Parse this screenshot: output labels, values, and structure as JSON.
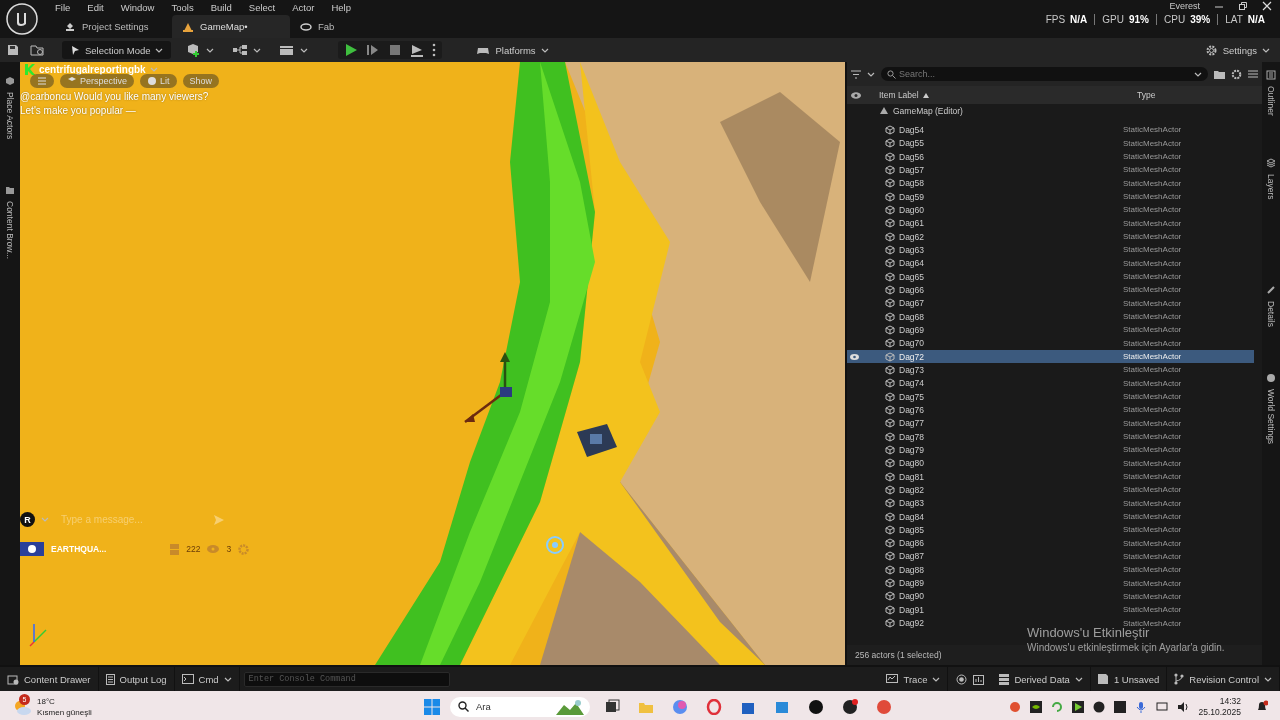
{
  "menu": [
    "File",
    "Edit",
    "Window",
    "Tools",
    "Build",
    "Select",
    "Actor",
    "Help"
  ],
  "tabs": [
    {
      "label": "Project Settings",
      "selected": false
    },
    {
      "label": "GameMap•",
      "selected": true
    },
    {
      "label": "Fab",
      "selected": false
    }
  ],
  "perf": {
    "title": "Everest",
    "stats": [
      {
        "name": "FPS",
        "value": "N/A"
      },
      {
        "name": "GPU",
        "value": "91%"
      },
      {
        "name": "CPU",
        "value": "39%"
      },
      {
        "name": "LAT",
        "value": "N/A"
      }
    ]
  },
  "toolbar": {
    "mode": "Selection Mode",
    "platforms": "Platforms",
    "settings": "Settings"
  },
  "left_tabs": [
    "Place Actors",
    "Content Brow..."
  ],
  "viewport": {
    "buttons": [
      "Perspective",
      "Lit",
      "Show"
    ]
  },
  "chat": {
    "user": "centrifugalreportingbk",
    "lines": [
      "@carboncu Would you like many viewers?",
      "Let's make you popular —"
    ],
    "avatar": "R",
    "input_placeholder": "Type a message...",
    "channel": "EARTHQUA...",
    "count_1": "222",
    "count_2": "3"
  },
  "outliner": {
    "search_placeholder": "Search...",
    "columns": [
      "Item Label",
      "Type"
    ],
    "root": "GameMap (Editor)",
    "footer": "256 actors (1 selected)",
    "rows": [
      {
        "label": "Dag54",
        "type": "StaticMeshActor",
        "selected": false
      },
      {
        "label": "Dag55",
        "type": "StaticMeshActor",
        "selected": false
      },
      {
        "label": "Dag56",
        "type": "StaticMeshActor",
        "selected": false
      },
      {
        "label": "Dag57",
        "type": "StaticMeshActor",
        "selected": false
      },
      {
        "label": "Dag58",
        "type": "StaticMeshActor",
        "selected": false
      },
      {
        "label": "Dag59",
        "type": "StaticMeshActor",
        "selected": false
      },
      {
        "label": "Dag60",
        "type": "StaticMeshActor",
        "selected": false
      },
      {
        "label": "Dag61",
        "type": "StaticMeshActor",
        "selected": false
      },
      {
        "label": "Dag62",
        "type": "StaticMeshActor",
        "selected": false
      },
      {
        "label": "Dag63",
        "type": "StaticMeshActor",
        "selected": false
      },
      {
        "label": "Dag64",
        "type": "StaticMeshActor",
        "selected": false
      },
      {
        "label": "Dag65",
        "type": "StaticMeshActor",
        "selected": false
      },
      {
        "label": "Dag66",
        "type": "StaticMeshActor",
        "selected": false
      },
      {
        "label": "Dag67",
        "type": "StaticMeshActor",
        "selected": false
      },
      {
        "label": "Dag68",
        "type": "StaticMeshActor",
        "selected": false
      },
      {
        "label": "Dag69",
        "type": "StaticMeshActor",
        "selected": false
      },
      {
        "label": "Dag70",
        "type": "StaticMeshActor",
        "selected": false
      },
      {
        "label": "Dag72",
        "type": "StaticMeshActor",
        "selected": true
      },
      {
        "label": "Dag73",
        "type": "StaticMeshActor",
        "selected": false
      },
      {
        "label": "Dag74",
        "type": "StaticMeshActor",
        "selected": false
      },
      {
        "label": "Dag75",
        "type": "StaticMeshActor",
        "selected": false
      },
      {
        "label": "Dag76",
        "type": "StaticMeshActor",
        "selected": false
      },
      {
        "label": "Dag77",
        "type": "StaticMeshActor",
        "selected": false
      },
      {
        "label": "Dag78",
        "type": "StaticMeshActor",
        "selected": false
      },
      {
        "label": "Dag79",
        "type": "StaticMeshActor",
        "selected": false
      },
      {
        "label": "Dag80",
        "type": "StaticMeshActor",
        "selected": false
      },
      {
        "label": "Dag81",
        "type": "StaticMeshActor",
        "selected": false
      },
      {
        "label": "Dag82",
        "type": "StaticMeshActor",
        "selected": false
      },
      {
        "label": "Dag83",
        "type": "StaticMeshActor",
        "selected": false
      },
      {
        "label": "Dag84",
        "type": "StaticMeshActor",
        "selected": false
      },
      {
        "label": "Dag85",
        "type": "StaticMeshActor",
        "selected": false
      },
      {
        "label": "Dag86",
        "type": "StaticMeshActor",
        "selected": false
      },
      {
        "label": "Dag87",
        "type": "StaticMeshActor",
        "selected": false
      },
      {
        "label": "Dag88",
        "type": "StaticMeshActor",
        "selected": false
      },
      {
        "label": "Dag89",
        "type": "StaticMeshActor",
        "selected": false
      },
      {
        "label": "Dag90",
        "type": "StaticMeshActor",
        "selected": false
      },
      {
        "label": "Dag91",
        "type": "StaticMeshActor",
        "selected": false
      },
      {
        "label": "Dag92",
        "type": "StaticMeshActor",
        "selected": false
      }
    ]
  },
  "right_tabs": [
    "Outliner",
    "Layers",
    "Details",
    "World Settings"
  ],
  "status": {
    "content_drawer": "Content Drawer",
    "output_log": "Output Log",
    "cmd": "Cmd",
    "console_placeholder": "Enter Console Command",
    "trace": "Trace",
    "derived": "Derived Data",
    "unsaved": "1 Unsaved",
    "revision": "Revision Control"
  },
  "activation": {
    "title": "Windows'u Etkinleştir",
    "text": "Windows'u etkinleştirmek için Ayarlar'a gidin."
  },
  "taskbar": {
    "badge": "5",
    "temp": "18°C",
    "weather": "Kısmen güneşli",
    "search_placeholder": "Ara",
    "time": "14:32",
    "date": "25.10.2025"
  }
}
